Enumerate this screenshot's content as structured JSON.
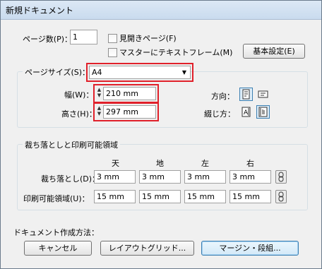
{
  "window": {
    "title": "新規ドキュメント"
  },
  "pages": {
    "label": "ページ数(P)：",
    "value": "1",
    "spread_label": "見開きページ(F)",
    "master_label": "マスターにテキストフレーム(M)",
    "basic_settings": "基本設定(E)"
  },
  "page_size": {
    "legend": "ページサイズ(S)：",
    "selected": "A4",
    "width_label": "幅(W)：",
    "width_value": "210 mm",
    "height_label": "高さ(H)：",
    "height_value": "297 mm",
    "orientation_label": "方向：",
    "binding_label": "綴じ方："
  },
  "bleed": {
    "legend": "裁ち落としと印刷可能領域",
    "columns": [
      "天",
      "地",
      "左",
      "右"
    ],
    "bleed_label": "裁ち落とし(D)：",
    "bleed_values": [
      "3 mm",
      "3 mm",
      "3 mm",
      "3 mm"
    ],
    "slug_label": "印刷可能領域(U)：",
    "slug_values": [
      "15 mm",
      "15 mm",
      "15 mm",
      "15 mm"
    ]
  },
  "create": {
    "label": "ドキュメント作成方法：",
    "cancel": "キャンセル",
    "layout_grid": "レイアウトグリッド...",
    "margins_columns": "マージン・段組..."
  },
  "colors": {
    "highlight": "#e0202a",
    "accent": "#3c7fb1"
  }
}
